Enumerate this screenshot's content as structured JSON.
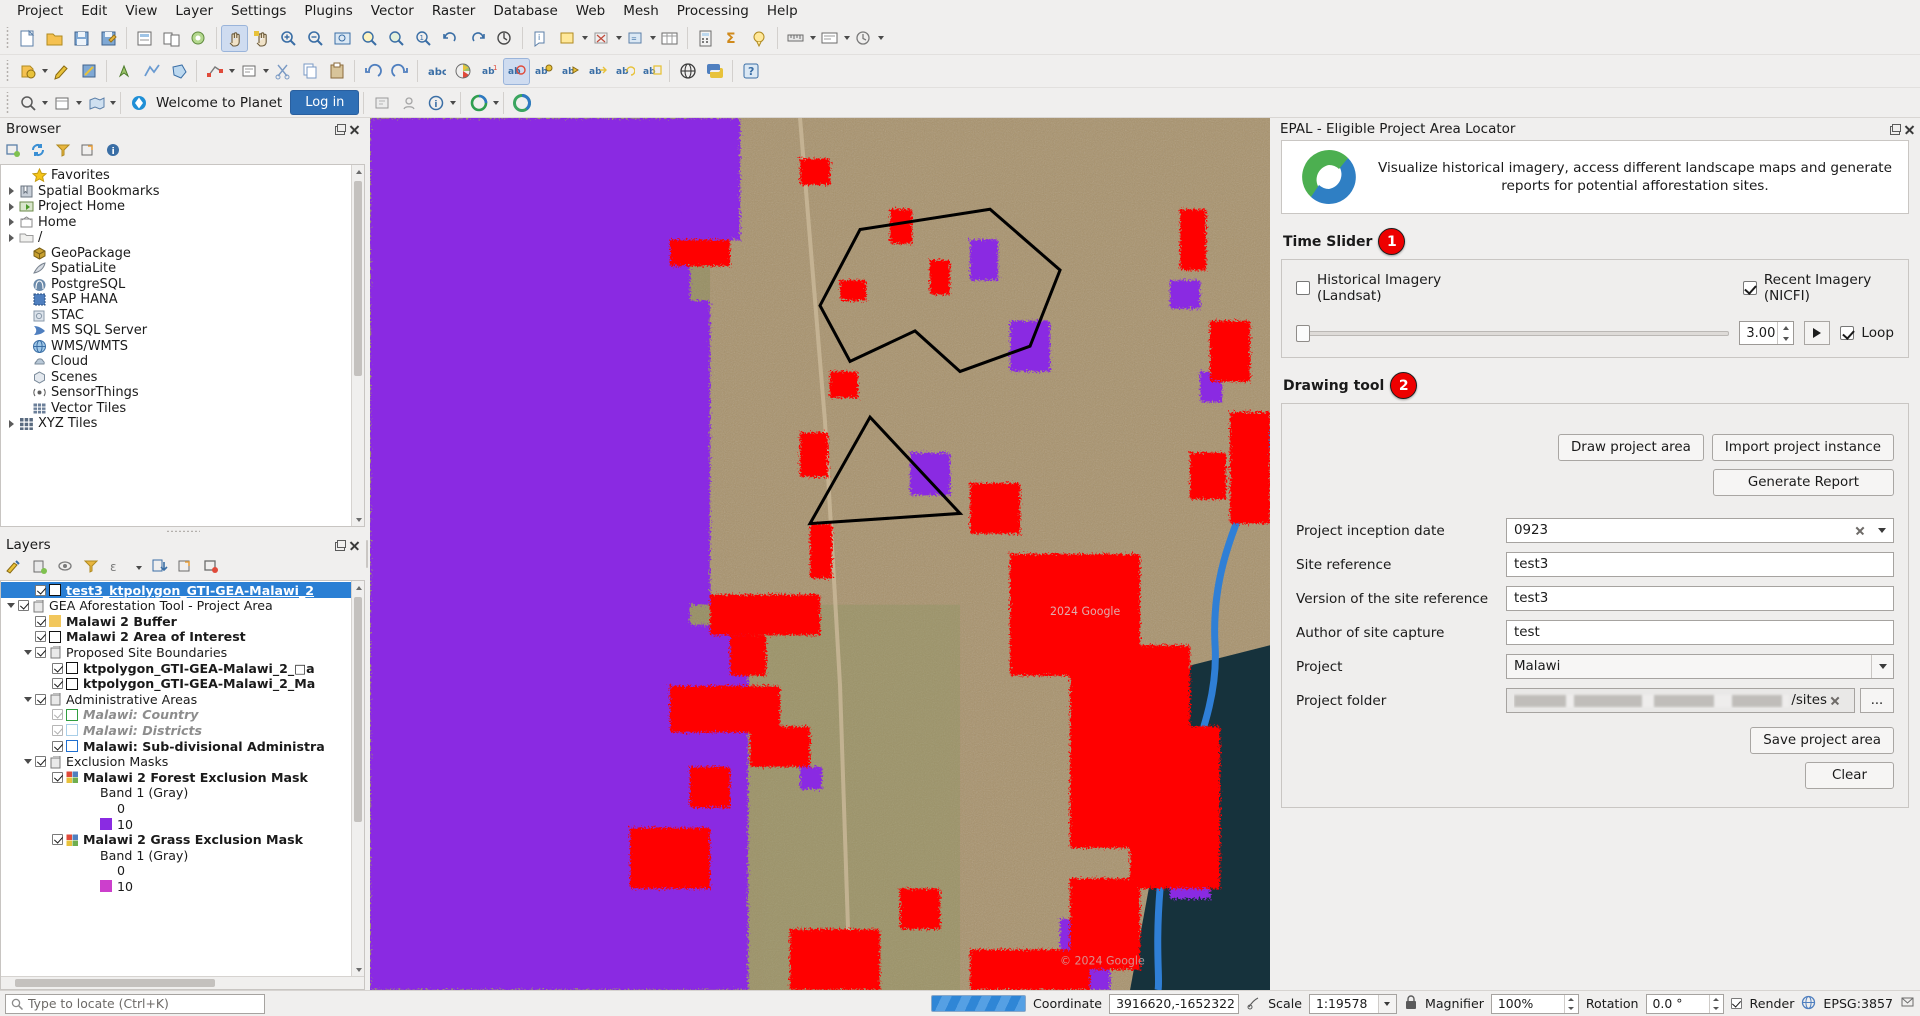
{
  "menubar": {
    "items": [
      "Project",
      "Edit",
      "View",
      "Layer",
      "Settings",
      "Plugins",
      "Vector",
      "Raster",
      "Database",
      "Web",
      "Mesh",
      "Processing",
      "Help"
    ]
  },
  "planet_bar": {
    "welcome_label": "Welcome to Planet",
    "login_label": "Log in"
  },
  "browser_panel": {
    "title": "Browser",
    "items": [
      {
        "label": "Favorites",
        "icon": "star-icon",
        "expandable": false,
        "indent": 1
      },
      {
        "label": "Spatial Bookmarks",
        "icon": "bookmark-icon",
        "expandable": true,
        "indent": 0
      },
      {
        "label": "Project Home",
        "icon": "project-home-icon",
        "expandable": true,
        "indent": 0
      },
      {
        "label": "Home",
        "icon": "home-icon",
        "expandable": true,
        "indent": 0
      },
      {
        "label": "/",
        "icon": "folder-icon",
        "expandable": true,
        "indent": 0
      },
      {
        "label": "GeoPackage",
        "icon": "geopackage-icon",
        "expandable": false,
        "indent": 1
      },
      {
        "label": "SpatiaLite",
        "icon": "spatialite-icon",
        "expandable": false,
        "indent": 1
      },
      {
        "label": "PostgreSQL",
        "icon": "postgresql-icon",
        "expandable": false,
        "indent": 1
      },
      {
        "label": "SAP HANA",
        "icon": "sap-hana-icon",
        "expandable": false,
        "indent": 1
      },
      {
        "label": "STAC",
        "icon": "stac-icon",
        "expandable": false,
        "indent": 1
      },
      {
        "label": "MS SQL Server",
        "icon": "mssql-icon",
        "expandable": false,
        "indent": 1
      },
      {
        "label": "WMS/WMTS",
        "icon": "wms-icon",
        "expandable": false,
        "indent": 1
      },
      {
        "label": "Cloud",
        "icon": "cloud-icon",
        "expandable": false,
        "indent": 1
      },
      {
        "label": "Scenes",
        "icon": "scenes-icon",
        "expandable": false,
        "indent": 1
      },
      {
        "label": "SensorThings",
        "icon": "sensorthings-icon",
        "expandable": false,
        "indent": 1
      },
      {
        "label": "Vector Tiles",
        "icon": "vector-tiles-icon",
        "expandable": false,
        "indent": 1
      },
      {
        "label": "XYZ Tiles",
        "icon": "xyz-tiles-icon",
        "expandable": true,
        "indent": 0
      }
    ]
  },
  "layers_panel": {
    "title": "Layers",
    "items": [
      {
        "label": "test3_ktpolygon_GTI-GEA-Malawi_2",
        "indent": 1,
        "checked": true,
        "selected": true,
        "bold": true,
        "swatch": "outline-dark",
        "type": "layer"
      },
      {
        "label": "GEA Aforestation Tool - Project Area",
        "indent": 0,
        "checked": true,
        "expand": "open",
        "type": "group"
      },
      {
        "label": "Malawi 2 Buffer",
        "indent": 1,
        "checked": true,
        "bold": true,
        "swatch": "fill-orange",
        "type": "layer"
      },
      {
        "label": "Malawi 2 Area of Interest",
        "indent": 1,
        "checked": true,
        "bold": true,
        "swatch": "outline-dark",
        "type": "layer"
      },
      {
        "label": "Proposed Site Boundaries",
        "indent": 1,
        "checked": true,
        "expand": "open",
        "type": "group"
      },
      {
        "label": "ktpolygon_GTI-GEA-Malawi_2_□a",
        "indent": 2,
        "checked": true,
        "bold": true,
        "swatch": "outline-dark",
        "type": "layer"
      },
      {
        "label": "ktpolygon_GTI-GEA-Malawi_2_Ma",
        "indent": 2,
        "checked": true,
        "bold": true,
        "swatch": "outline-dark",
        "type": "layer"
      },
      {
        "label": "Administrative Areas",
        "indent": 1,
        "checked": true,
        "expand": "open",
        "type": "group"
      },
      {
        "label": "Malawi: Country",
        "indent": 2,
        "checked": true,
        "dim": true,
        "swatch": "outline-green",
        "type": "layer"
      },
      {
        "label": "Malawi: Districts",
        "indent": 2,
        "checked": true,
        "dim": true,
        "swatch": "outline-lightblue",
        "type": "layer"
      },
      {
        "label": "Malawi: Sub-divisional Administra",
        "indent": 2,
        "checked": true,
        "bold": true,
        "swatch": "outline-blue",
        "type": "layer"
      },
      {
        "label": "Exclusion Masks",
        "indent": 1,
        "checked": true,
        "expand": "open",
        "type": "group"
      },
      {
        "label": "Malawi 2 Forest Exclusion Mask",
        "indent": 2,
        "checked": true,
        "bold": true,
        "swatch": "raster",
        "type": "layer"
      },
      {
        "label": "Band 1 (Gray)",
        "indent": 3,
        "type": "band"
      },
      {
        "label": "0",
        "indent": 4,
        "swatch": "none",
        "type": "legend"
      },
      {
        "label": "10",
        "indent": 4,
        "swatch": "fill-purple",
        "type": "legend"
      },
      {
        "label": "Malawi 2 Grass Exclusion Mask",
        "indent": 2,
        "checked": true,
        "bold": true,
        "swatch": "raster",
        "type": "layer"
      },
      {
        "label": "Band 1 (Gray)",
        "indent": 3,
        "type": "band"
      },
      {
        "label": "0",
        "indent": 4,
        "swatch": "none",
        "type": "legend"
      },
      {
        "label": "10",
        "indent": 4,
        "swatch": "fill-magenta",
        "type": "legend"
      }
    ]
  },
  "dock": {
    "title": "EPAL - Eligible Project Area Locator",
    "banner_text": "Visualize historical imagery, access different landscape maps and generate reports for potential afforestation sites.",
    "time_slider": {
      "title": "Time Slider",
      "badge": "1",
      "historical_label": "Historical Imagery (Landsat)",
      "historical_checked": false,
      "recent_label": "Recent Imagery (NICFI)",
      "recent_checked": true,
      "speed_value": "3.00",
      "loop_label": "Loop",
      "loop_checked": true
    },
    "drawing_tool": {
      "title": "Drawing tool",
      "badge": "2",
      "draw_project_area": "Draw project area",
      "import_project_instance": "Import project instance",
      "generate_report": "Generate Report",
      "fields": [
        {
          "label": "Project inception date",
          "value": "0923",
          "kind": "date"
        },
        {
          "label": "Site reference",
          "value": "test3",
          "kind": "text"
        },
        {
          "label": "Version of the site reference",
          "value": "test3",
          "kind": "text"
        },
        {
          "label": "Author of site capture",
          "value": "test",
          "kind": "text"
        },
        {
          "label": "Project",
          "value": "Malawi",
          "kind": "combo"
        },
        {
          "label": "Project folder",
          "value": "/sites",
          "kind": "folder"
        }
      ],
      "folder_browse": "...",
      "save_project_area": "Save project area",
      "clear": "Clear"
    }
  },
  "status_bar": {
    "locator_placeholder": "Type to locate (Ctrl+K)",
    "coordinate_label": "Coordinate",
    "coordinate_value": "3916620,-1652322",
    "scale_label": "Scale",
    "scale_value": "1:19578",
    "magnifier_label": "Magnifier",
    "magnifier_value": "100%",
    "rotation_label": "Rotation",
    "rotation_value": "0.0 °",
    "render_label": "Render",
    "render_checked": true,
    "crs_value": "EPSG:3857"
  },
  "colors": {
    "accent_blue": "#2a7fd4",
    "badge_red": "#ee0000",
    "mask_purple": "#8a2be2",
    "mask_red": "#ff0000",
    "panel_bg": "#f0efee"
  }
}
